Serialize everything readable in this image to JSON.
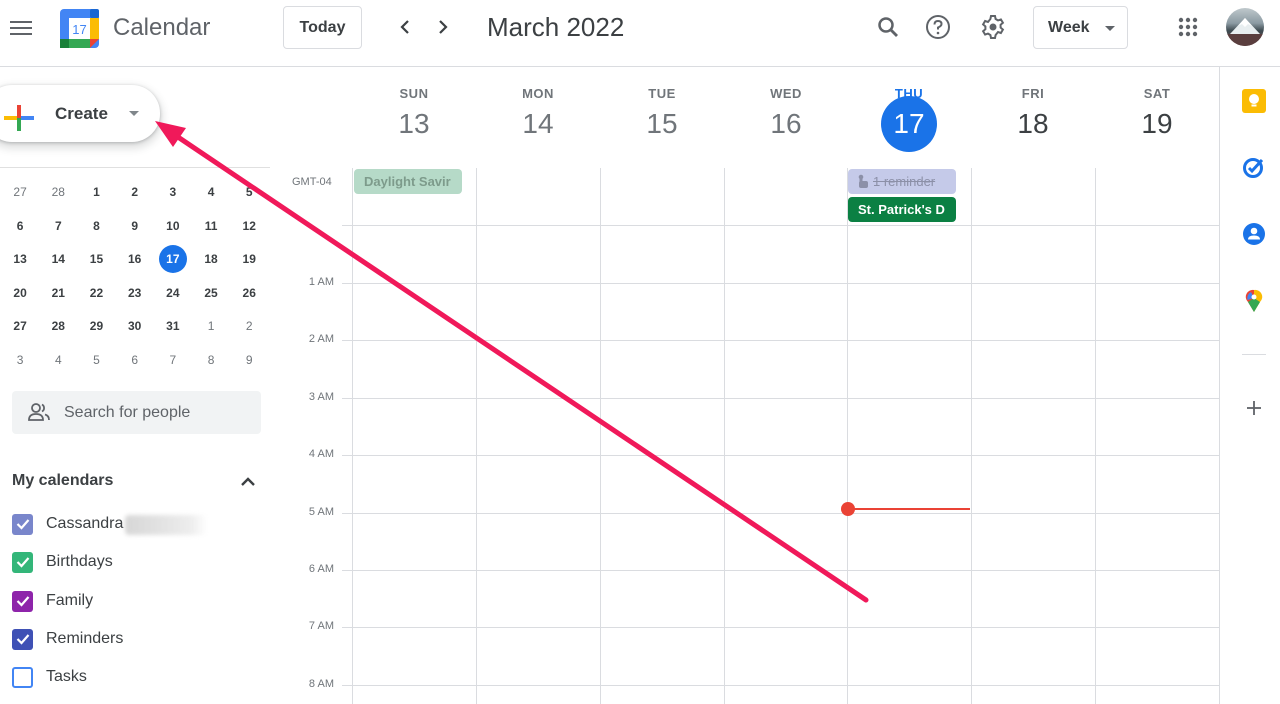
{
  "header": {
    "menu_icon": "hamburger-menu-icon",
    "app_title": "Calendar",
    "logo_day": "17",
    "today_label": "Today",
    "prev_icon": "chevron-left-icon",
    "next_icon": "chevron-right-icon",
    "current_period": "March 2022",
    "search_icon": "search-icon",
    "help_icon": "help-circle-icon",
    "settings_icon": "gear-icon",
    "view_selected": "Week",
    "apps_icon": "apps-grid-icon",
    "avatar_icon": "user-avatar"
  },
  "sidebar": {
    "create_label": "Create",
    "mini_calendar": {
      "weeks": [
        [
          {
            "d": "27",
            "other": true
          },
          {
            "d": "28",
            "other": true
          },
          {
            "d": "1"
          },
          {
            "d": "2"
          },
          {
            "d": "3"
          },
          {
            "d": "4"
          },
          {
            "d": "5"
          }
        ],
        [
          {
            "d": "6"
          },
          {
            "d": "7"
          },
          {
            "d": "8"
          },
          {
            "d": "9"
          },
          {
            "d": "10"
          },
          {
            "d": "11"
          },
          {
            "d": "12"
          }
        ],
        [
          {
            "d": "13"
          },
          {
            "d": "14"
          },
          {
            "d": "15"
          },
          {
            "d": "16"
          },
          {
            "d": "17",
            "today": true
          },
          {
            "d": "18"
          },
          {
            "d": "19"
          }
        ],
        [
          {
            "d": "20"
          },
          {
            "d": "21"
          },
          {
            "d": "22"
          },
          {
            "d": "23"
          },
          {
            "d": "24"
          },
          {
            "d": "25"
          },
          {
            "d": "26"
          }
        ],
        [
          {
            "d": "27"
          },
          {
            "d": "28"
          },
          {
            "d": "29"
          },
          {
            "d": "30"
          },
          {
            "d": "31"
          },
          {
            "d": "1",
            "other": true
          },
          {
            "d": "2",
            "other": true
          }
        ],
        [
          {
            "d": "3",
            "other": true
          },
          {
            "d": "4",
            "other": true
          },
          {
            "d": "5",
            "other": true
          },
          {
            "d": "6",
            "other": true
          },
          {
            "d": "7",
            "other": true
          },
          {
            "d": "8",
            "other": true
          },
          {
            "d": "9",
            "other": true
          }
        ]
      ]
    },
    "people_search_placeholder": "Search for people",
    "my_calendars_title": "My calendars",
    "calendars": [
      {
        "label": "Cassandra",
        "checked": true,
        "color": "#7986cb"
      },
      {
        "label": "Birthdays",
        "checked": true,
        "color": "#33b679"
      },
      {
        "label": "Family",
        "checked": true,
        "color": "#8e24aa"
      },
      {
        "label": "Reminders",
        "checked": true,
        "color": "#3f51b5"
      },
      {
        "label": "Tasks",
        "checked": false,
        "color": "#4285f4"
      }
    ]
  },
  "week": {
    "timezone": "GMT-04",
    "days": [
      {
        "name": "SUN",
        "num": "13",
        "state": "past"
      },
      {
        "name": "MON",
        "num": "14",
        "state": "past"
      },
      {
        "name": "TUE",
        "num": "15",
        "state": "past"
      },
      {
        "name": "WED",
        "num": "16",
        "state": "past"
      },
      {
        "name": "THU",
        "num": "17",
        "state": "today"
      },
      {
        "name": "FRI",
        "num": "18",
        "state": "future"
      },
      {
        "name": "SAT",
        "num": "19",
        "state": "future"
      }
    ],
    "hours": [
      "1 AM",
      "2 AM",
      "3 AM",
      "4 AM",
      "5 AM",
      "6 AM",
      "7 AM",
      "8 AM"
    ],
    "all_day_events": [
      {
        "title": "Daylight Savir",
        "day": "SUN",
        "color": "#b6dac8"
      },
      {
        "title": "1 reminder",
        "day": "THU",
        "color": "#c5cae9",
        "completed": true
      },
      {
        "title": "St. Patrick's D",
        "day": "THU",
        "color": "#0b8043"
      }
    ],
    "current_time_color": "#ea4335"
  },
  "side_panel": {
    "items": [
      "keep-icon",
      "tasks-icon",
      "contacts-icon",
      "maps-icon"
    ],
    "add_icon": "plus-icon"
  },
  "annotation": {
    "arrow_color": "#f0195a",
    "points_to": "Create"
  },
  "colors": {
    "accent": "#1a73e8",
    "now_line": "#ea4335"
  }
}
